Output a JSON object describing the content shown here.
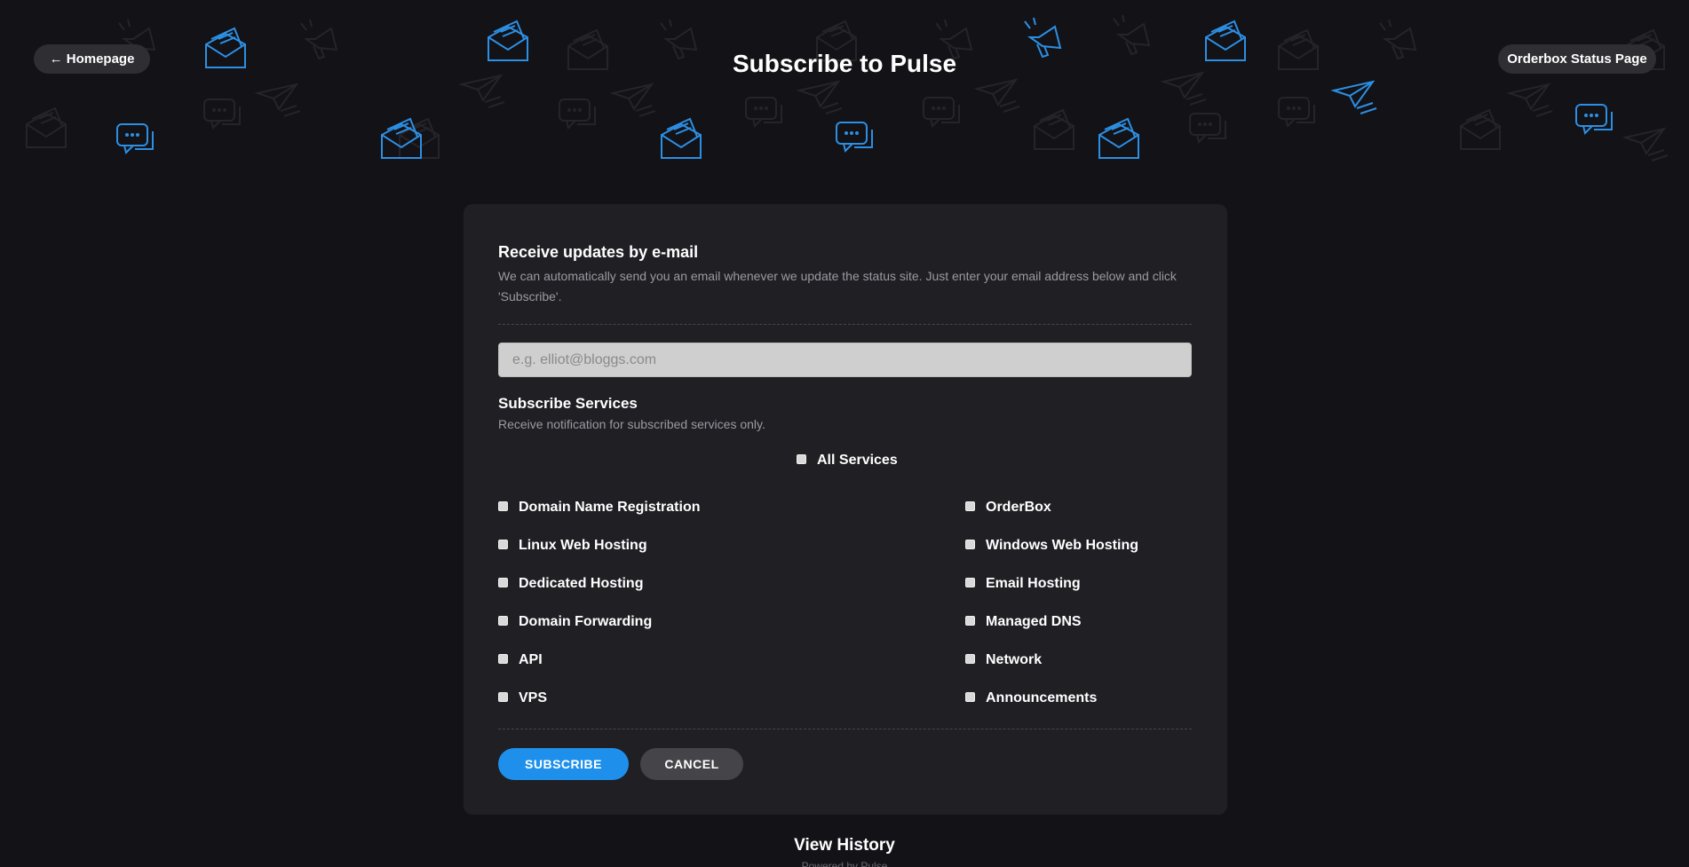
{
  "header": {
    "home_button": "← Homepage",
    "title": "Subscribe to Pulse",
    "status_button": "Orderbox Status Page"
  },
  "email_section": {
    "title": "Receive updates by e-mail",
    "description": "We can automatically send you an email whenever we update the status site. Just enter your email address below and click 'Subscribe'.",
    "input_placeholder": "e.g. elliot@bloggs.com",
    "input_value": ""
  },
  "services_section": {
    "title": "Subscribe Services",
    "description": "Receive notification for subscribed services only.",
    "all_label": "All Services",
    "left_column": [
      "Domain Name Registration",
      "Linux Web Hosting",
      "Dedicated Hosting",
      "Domain Forwarding",
      "API",
      "VPS"
    ],
    "right_column": [
      "OrderBox",
      "Windows Web Hosting",
      "Email Hosting",
      "Managed DNS",
      "Network",
      "Announcements"
    ]
  },
  "actions": {
    "subscribe_label": "SUBSCRIBE",
    "cancel_label": "CANCEL"
  },
  "footer": {
    "history_link": "View History",
    "powered_by": "Powered by Pulse"
  },
  "colors": {
    "background": "#121217",
    "card": "#1f1f24",
    "accent": "#1e90ec",
    "icon_dim": "#2a2a30"
  }
}
